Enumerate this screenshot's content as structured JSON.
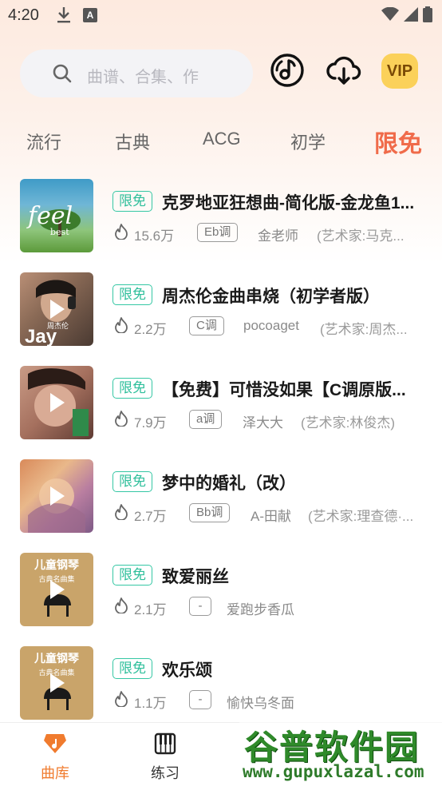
{
  "status_bar": {
    "time": "4:20",
    "a_icon_label": "A"
  },
  "search": {
    "placeholder": "曲谱、合集、作"
  },
  "header": {
    "vip_label": "VIP"
  },
  "category_tabs": [
    {
      "label": "流行"
    },
    {
      "label": "古典"
    },
    {
      "label": "ACG"
    },
    {
      "label": "初学"
    },
    {
      "label": "限免",
      "active": true
    }
  ],
  "songs": [
    {
      "tag": "限免",
      "title": "克罗地亚狂想曲-简化版-金龙鱼1...",
      "hot": "15.6万",
      "key": "Eb调",
      "author": "金老师",
      "artist": "(艺术家:马克...",
      "cover_text": "feel",
      "cover_sub": "best"
    },
    {
      "tag": "限免",
      "title": "周杰伦金曲串烧（初学者版）",
      "hot": "2.2万",
      "key": "C调",
      "author": "pocoaget",
      "artist": "(艺术家:周杰...",
      "cover_text": "Jay",
      "cover_sub": "周杰伦"
    },
    {
      "tag": "限免",
      "title": "【免费】可惜没如果【C调原版...",
      "hot": "7.9万",
      "key": "a调",
      "author": "泽大大",
      "artist": "(艺术家:林俊杰)"
    },
    {
      "tag": "限免",
      "title": "梦中的婚礼（改）",
      "hot": "2.7万",
      "key": "Bb调",
      "author": "A-田献",
      "artist": "(艺术家:理查德·..."
    },
    {
      "tag": "限免",
      "title": "致爱丽丝",
      "hot": "2.1万",
      "key": "-",
      "author": "爱跑步香瓜",
      "artist": "",
      "cover_text": "儿童钢琴",
      "cover_sub": "古典名曲集"
    },
    {
      "tag": "限免",
      "title": "欢乐颂",
      "hot": "1.1万",
      "key": "-",
      "author": "愉快乌冬面",
      "artist": "",
      "cover_text": "儿童钢琴",
      "cover_sub": "古典名曲集"
    }
  ],
  "bottom_nav": [
    {
      "label": "曲库",
      "active": true
    },
    {
      "label": "练习"
    }
  ],
  "watermark": {
    "title": "谷普软件园",
    "url": "www.gupuxlazal.com"
  }
}
